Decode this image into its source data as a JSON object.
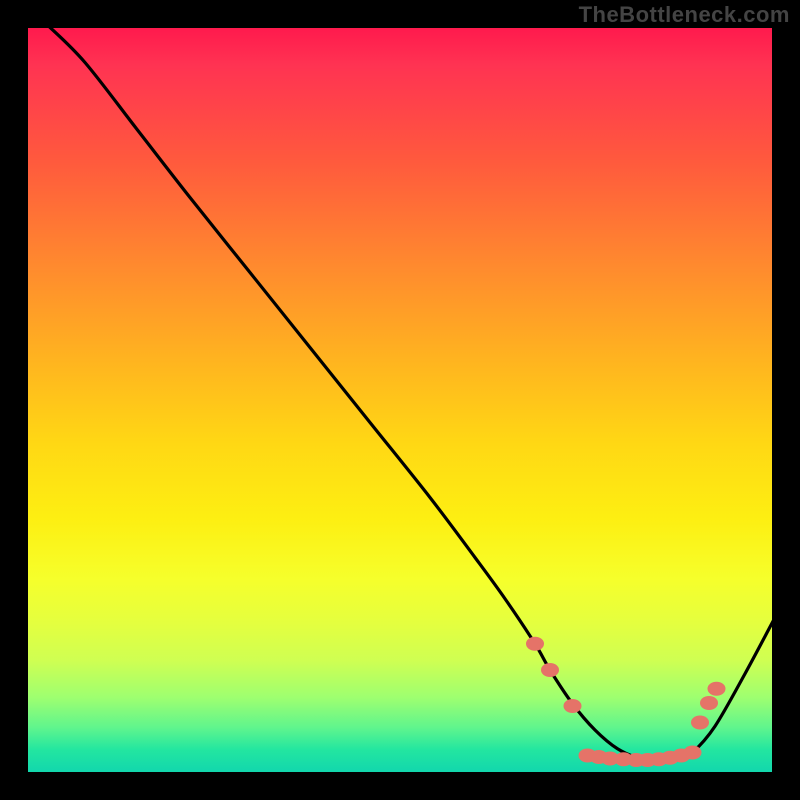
{
  "watermark": "TheBottleneck.com",
  "colors": {
    "curve": "#000000",
    "markers": "#e57368",
    "frame": "#000000"
  },
  "chart_data": {
    "type": "line",
    "title": "",
    "xlabel": "",
    "ylabel": "",
    "xlim": [
      0,
      100
    ],
    "ylim": [
      0,
      100
    ],
    "grid": false,
    "series": [
      {
        "name": "bottleneck-curve",
        "x": [
          3,
          8,
          15,
          22,
          30,
          38,
          46,
          54,
          60,
          64,
          68,
          70,
          73,
          76,
          79,
          82,
          85,
          87,
          89,
          92,
          96,
          100
        ],
        "y": [
          100,
          95,
          86,
          77,
          67,
          57,
          47,
          37,
          29,
          23.5,
          17.5,
          14,
          9.5,
          6,
          3.5,
          2.2,
          1.8,
          2.0,
          3.0,
          6.5,
          13.5,
          21
        ]
      }
    ],
    "markers": {
      "name": "highlight-dots",
      "color": "#e57368",
      "points": [
        {
          "x": 68.0,
          "y": 17.5
        },
        {
          "x": 70.0,
          "y": 14.0
        },
        {
          "x": 73.0,
          "y": 9.2
        },
        {
          "x": 75.0,
          "y": 2.6
        },
        {
          "x": 76.5,
          "y": 2.4
        },
        {
          "x": 78.0,
          "y": 2.2
        },
        {
          "x": 79.8,
          "y": 2.1
        },
        {
          "x": 81.5,
          "y": 2.0
        },
        {
          "x": 83.0,
          "y": 2.0
        },
        {
          "x": 84.5,
          "y": 2.1
        },
        {
          "x": 86.0,
          "y": 2.3
        },
        {
          "x": 87.5,
          "y": 2.6
        },
        {
          "x": 89.0,
          "y": 3.0
        },
        {
          "x": 90.0,
          "y": 7.0
        },
        {
          "x": 91.2,
          "y": 9.6
        },
        {
          "x": 92.2,
          "y": 11.5
        }
      ]
    }
  }
}
